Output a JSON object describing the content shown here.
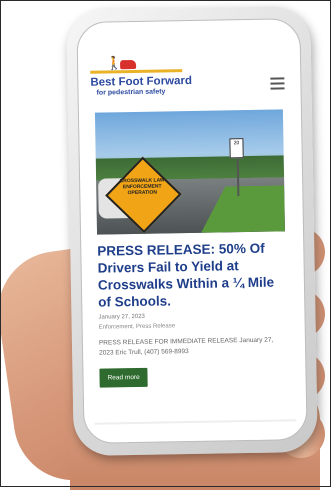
{
  "site": {
    "logo_title": "Best Foot Forward",
    "logo_subtitle": "for pedestrian safety",
    "logo_icon": "pedestrian-and-car-icon",
    "menu_icon": "hamburger-menu-icon",
    "brand_blue": "#2d4aa0",
    "accent_green": "#2f6b2f"
  },
  "post": {
    "hero_sign_text": "CROSSWALK LAW ENFORCEMENT OPERATION",
    "title": "PRESS RELEASE: 50% Of Drivers Fail to Yield at Crosswalks Within a ¼ Mile of Schools.",
    "date": "January 27, 2023",
    "categories": "Enforcement, Press Release",
    "excerpt": "PRESS RELEASE FOR IMMEDIATE RELEASE January 27, 2023 Eric Trull, (407) 569-8993",
    "read_more_label": "Read more"
  }
}
